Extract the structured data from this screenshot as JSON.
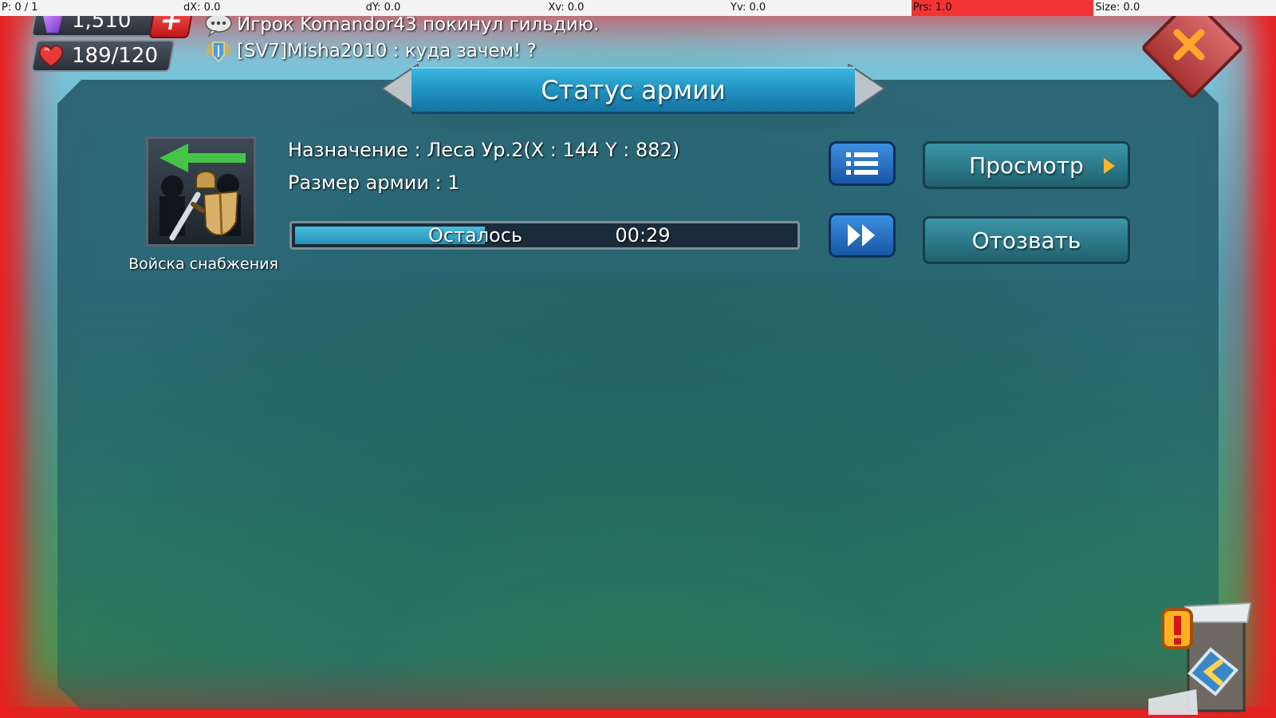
{
  "debug": {
    "p": "P: 0 / 1",
    "dx": "dX: 0.0",
    "dy": "dY: 0.0",
    "xv": "Xv: 0.0",
    "yv": "Yv: 0.0",
    "prs": "Prs: 1.0",
    "size": "Size: 0.0"
  },
  "resources": {
    "gems": "1,510",
    "stamina": "189/120"
  },
  "chat": {
    "line1": "Игрок Komandor43 покинул гильдию.",
    "line2": "[SV7]Misha2010 : куда зачем! ?"
  },
  "dialog": {
    "title": "Статус армии"
  },
  "army": {
    "troop_label": "Войска снабжения",
    "destination": "Назначение : Леса Ур.2(X : 144 Y : 882)",
    "size": "Размер армии : 1",
    "progress_label": "Осталось",
    "time_left": "00:29",
    "progress_fraction": 0.38,
    "view_button": "Просмотр",
    "recall_button": "Отозвать"
  },
  "icons": {
    "close": "close-icon",
    "list": "list-icon",
    "speedup": "fast-forward-icon",
    "gem": "gem-icon",
    "heart": "heart-icon"
  },
  "colors": {
    "title_banner": "#1f8ebd",
    "action_button": "#2a7686",
    "icon_button": "#1856a5",
    "close_button": "#c04444",
    "alert_vignette": "#e62020"
  }
}
